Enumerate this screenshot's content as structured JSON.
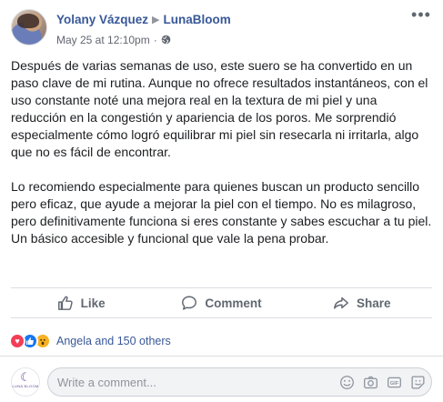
{
  "post": {
    "author": "Yolany Vázquez",
    "separator": "▶",
    "page": "LunaBloom",
    "timestamp": "May 25 at 12:10pm",
    "dot": "·",
    "paragraphs": [
      "Después de varias semanas de uso, este suero se ha convertido en un paso clave de mi rutina. Aunque no ofrece resultados instantáneos, con el uso constante noté una mejora real en la textura de mi piel y una reducción en la congestión y apariencia de los poros. Me sorprendió especialmente cómo logró equilibrar mi piel sin resecarla ni irritarla, algo que no es fácil de encontrar.",
      "Lo recomiendo especialmente para quienes buscan un producto sencillo pero eficaz, que ayude a mejorar la piel con el tiempo. No es milagroso, pero definitivamente funciona si eres constante y sabes escuchar a tu piel. Un básico accesible y funcional que vale la pena probar."
    ]
  },
  "actions": {
    "like": "Like",
    "comment": "Comment",
    "share": "Share"
  },
  "reactions": {
    "summary": "Angela and 150 others",
    "types": [
      "love",
      "like",
      "wow"
    ]
  },
  "comment": {
    "placeholder": "Write a comment...",
    "icons": [
      "emoji-icon",
      "camera-icon",
      "gif-icon",
      "sticker-icon"
    ],
    "page_avatar_text": "LUNA BLOOM"
  },
  "colors": {
    "link": "#385898",
    "secondary": "#606770",
    "love": "#f33e58",
    "like": "#1877f2",
    "wow": "#f7b125"
  }
}
